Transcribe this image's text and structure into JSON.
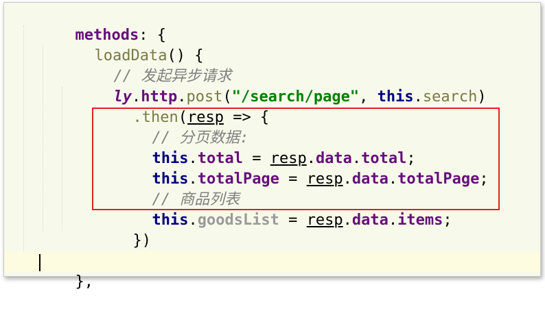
{
  "code_lines": [
    {
      "tokens": [
        "methods",
        ": {"
      ]
    },
    {
      "tokens": [
        "loadData",
        "() {"
      ]
    },
    {
      "tokens": [
        "// 发起异步请求"
      ]
    },
    {
      "tokens": [
        "ly",
        ".",
        "http",
        ".",
        "post",
        "(",
        "\"/search/page\"",
        ", ",
        "this",
        ".",
        "search",
        ")"
      ]
    },
    {
      "tokens": [
        ".then",
        "(",
        "resp",
        " => {"
      ]
    },
    {
      "tokens": [
        "// 分页数据:"
      ]
    },
    {
      "tokens": [
        "this",
        ".",
        "total",
        " = ",
        "resp",
        ".",
        "data",
        ".",
        "total",
        ";"
      ]
    },
    {
      "tokens": [
        "this",
        ".",
        "totalPage",
        " = ",
        "resp",
        ".",
        "data",
        ".",
        "totalPage",
        ";"
      ]
    },
    {
      "tokens": [
        "// 商品列表"
      ]
    },
    {
      "tokens": [
        "this",
        ".",
        "goodsList",
        " = ",
        "resp",
        ".",
        "data",
        ".",
        "items",
        ";"
      ]
    },
    {
      "tokens": [
        "})"
      ]
    },
    {
      "tokens": [
        "}"
      ]
    },
    {
      "tokens": [
        "},"
      ]
    }
  ],
  "colors": {
    "background": "#f7faeb",
    "keyword": "#000080",
    "property": "#660e7a",
    "string": "#008000",
    "comment": "#808080",
    "function": "#7a7a43",
    "highlight_box": "#e02020"
  }
}
